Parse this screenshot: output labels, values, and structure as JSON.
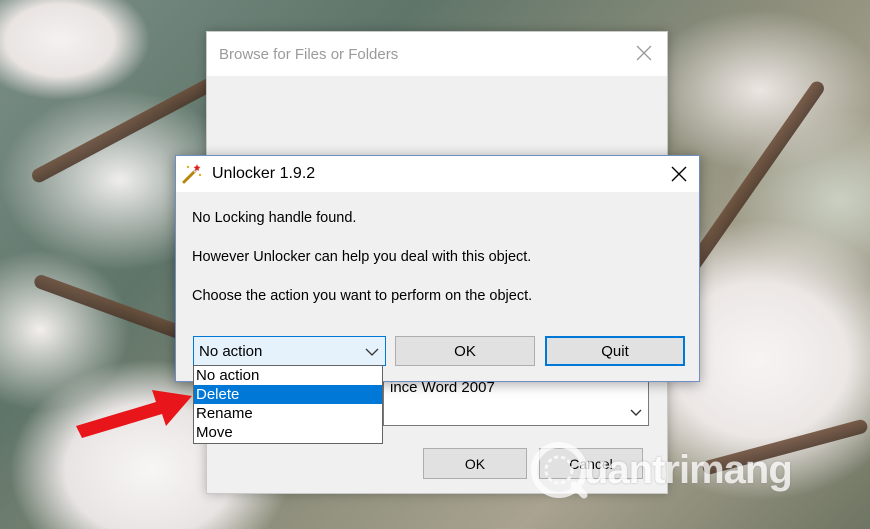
{
  "browse_dialog": {
    "title": "Browse for Files or Folders",
    "dropdown_text": "ince Word 2007",
    "ok_label": "OK",
    "cancel_label": "Cancel"
  },
  "unlocker_dialog": {
    "title": "Unlocker 1.9.2",
    "message_lines": [
      "No Locking handle found.",
      "However Unlocker can help you deal with this object.",
      "Choose the action you want to perform on the object."
    ],
    "action_select": {
      "value": "No action",
      "options": [
        "No action",
        "Delete",
        "Rename",
        "Move"
      ],
      "highlighted_option": "Delete"
    },
    "ok_label": "OK",
    "quit_label": "Quit"
  },
  "annotation": {
    "arrow_color": "#e8161b",
    "points_to": "Delete"
  },
  "watermark": {
    "text": "uantrimang",
    "icon": "quantrimang-logo-icon"
  },
  "colors": {
    "accent": "#0078d7",
    "select_bg": "#e5f1fb",
    "dialog_bg": "#f0f0f0"
  }
}
